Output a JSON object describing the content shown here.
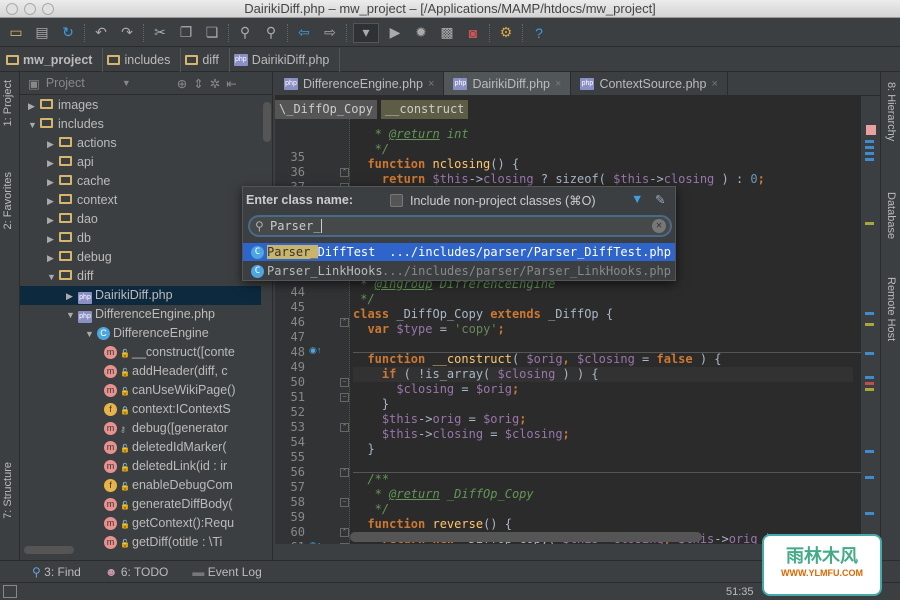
{
  "window": {
    "title": "DairikiDiff.php – mw_project – [/Applications/MAMP/htdocs/mw_project]"
  },
  "toolbar": {
    "icons": [
      "open-folder-icon",
      "save-icon",
      "sync-icon",
      "undo-icon",
      "redo-icon",
      "cut-icon",
      "copy-icon",
      "paste-icon",
      "find-icon",
      "replace-icon",
      "back-icon",
      "forward-icon",
      "run-config-dropdown",
      "run-icon",
      "debug-icon",
      "coverage-icon",
      "phpunit-icon",
      "settings-icon",
      "help-icon"
    ]
  },
  "navbar": {
    "crumbs": [
      "mw_project",
      "includes",
      "diff",
      "DairikiDiff.php"
    ]
  },
  "left_strip": {
    "tabs": [
      "1: Project",
      "2: Favorites",
      "7: Structure"
    ]
  },
  "project": {
    "title": "Project",
    "tree": [
      {
        "label": "images",
        "type": "folder",
        "depth": 0,
        "open": false
      },
      {
        "label": "includes",
        "type": "folder",
        "depth": 0,
        "open": true
      },
      {
        "label": "actions",
        "type": "folder",
        "depth": 1,
        "open": false
      },
      {
        "label": "api",
        "type": "folder",
        "depth": 1,
        "open": false
      },
      {
        "label": "cache",
        "type": "folder",
        "depth": 1,
        "open": false
      },
      {
        "label": "context",
        "type": "folder",
        "depth": 1,
        "open": false
      },
      {
        "label": "dao",
        "type": "folder",
        "depth": 1,
        "open": false
      },
      {
        "label": "db",
        "type": "folder",
        "depth": 1,
        "open": false
      },
      {
        "label": "debug",
        "type": "folder",
        "depth": 1,
        "open": false
      },
      {
        "label": "diff",
        "type": "folder",
        "depth": 1,
        "open": true
      },
      {
        "label": "DairikiDiff.php",
        "type": "php",
        "depth": 2,
        "open": false,
        "selected": true
      },
      {
        "label": "DifferenceEngine.php",
        "type": "php",
        "depth": 2,
        "open": true
      },
      {
        "label": "DifferenceEngine",
        "type": "class",
        "depth": 3,
        "open": true
      },
      {
        "label": "__construct([conte",
        "type": "m",
        "depth": 4,
        "vis": "public"
      },
      {
        "label": "addHeader(diff, c",
        "type": "m",
        "depth": 4,
        "vis": "public"
      },
      {
        "label": "canUseWikiPage()",
        "type": "m",
        "depth": 4,
        "vis": "public"
      },
      {
        "label": "context:IContextS",
        "type": "f",
        "depth": 4,
        "vis": "private"
      },
      {
        "label": "debug([generator",
        "type": "m",
        "depth": 4,
        "vis": "protected"
      },
      {
        "label": "deletedIdMarker(",
        "type": "m",
        "depth": 4,
        "vis": "public"
      },
      {
        "label": "deletedLink(id : ir",
        "type": "m",
        "depth": 4,
        "vis": "public"
      },
      {
        "label": "enableDebugCom",
        "type": "f",
        "depth": 4,
        "vis": "public"
      },
      {
        "label": "generateDiffBody(",
        "type": "m",
        "depth": 4,
        "vis": "public"
      },
      {
        "label": "getContext():Requ",
        "type": "m",
        "depth": 4,
        "vis": "public"
      },
      {
        "label": "getDiff(otitle : \\Ti",
        "type": "m",
        "depth": 4,
        "vis": "public"
      }
    ]
  },
  "tabs": [
    {
      "label": "DifferenceEngine.php",
      "active": false
    },
    {
      "label": "DairikiDiff.php",
      "active": true
    },
    {
      "label": "ContextSource.php",
      "active": false
    }
  ],
  "editor": {
    "breadcrumb": [
      "\\_DiffOp_Copy",
      "__construct"
    ],
    "lines": [
      {
        "n": 35,
        "t": [
          [
            "cm",
            "   * "
          ],
          [
            "tag",
            "@return"
          ],
          [
            "cm",
            " int"
          ]
        ]
      },
      {
        "n": 36,
        "t": [
          [
            "cm",
            "   */"
          ]
        ]
      },
      {
        "n": 37,
        "t": [
          [
            "kw",
            "  function "
          ],
          [
            "fn",
            "nclosing"
          ],
          [
            "",
            "() {"
          ]
        ]
      },
      {
        "n": 38,
        "t": [
          [
            "kw",
            "    return "
          ],
          [
            "var",
            "$this"
          ],
          [
            "",
            "->"
          ],
          [
            "var",
            "closing"
          ],
          [
            "",
            " ? sizeof( "
          ],
          [
            "var",
            "$this"
          ],
          [
            "",
            "->"
          ],
          [
            "var",
            "closing"
          ],
          [
            "",
            " ) : "
          ],
          [
            "num",
            "0"
          ],
          [
            "kw",
            ";"
          ]
        ]
      },
      {
        "n": 39,
        "t": [
          [
            "",
            "  }"
          ]
        ]
      },
      {
        "n": 40,
        "t": []
      },
      {
        "n": 41,
        "t": []
      },
      {
        "n": 42,
        "t": []
      },
      {
        "n": 43,
        "t": []
      },
      {
        "n": 44,
        "t": []
      },
      {
        "n": 45,
        "t": [
          [
            "cm",
            " * "
          ],
          [
            "tag",
            "@ingroup"
          ],
          [
            "cm",
            " DifferenceEngine"
          ]
        ]
      },
      {
        "n": 46,
        "t": [
          [
            "cm",
            " */"
          ]
        ]
      },
      {
        "n": 47,
        "t": [
          [
            "kw",
            "class "
          ],
          [
            "",
            "_DiffOp_Copy "
          ],
          [
            "kw",
            "extends "
          ],
          [
            "",
            "_DiffOp {"
          ]
        ]
      },
      {
        "n": 48,
        "t": [
          [
            "kw",
            "  var "
          ],
          [
            "var",
            "$type"
          ],
          [
            "",
            " = "
          ],
          [
            "str",
            "'copy'"
          ],
          [
            "kw",
            ";"
          ]
        ]
      },
      {
        "n": 49,
        "t": []
      },
      {
        "n": 50,
        "t": [
          [
            "kw",
            "  function "
          ],
          [
            "fn",
            "__construct"
          ],
          [
            "",
            "( "
          ],
          [
            "var",
            "$orig"
          ],
          [
            "kw",
            ", "
          ],
          [
            "var",
            "$closing"
          ],
          [
            "",
            " = "
          ],
          [
            "kw",
            "false"
          ],
          [
            "",
            " ) {"
          ]
        ]
      },
      {
        "n": 51,
        "t": [
          [
            "kw",
            "    if "
          ],
          [
            "",
            "( !is_array( "
          ],
          [
            "var",
            "$closing"
          ],
          [
            "",
            " ) ) {"
          ]
        ]
      },
      {
        "n": 52,
        "t": [
          [
            "var",
            "      $closing"
          ],
          [
            "",
            " = "
          ],
          [
            "var",
            "$orig"
          ],
          [
            "kw",
            ";"
          ]
        ]
      },
      {
        "n": 53,
        "t": [
          [
            "",
            "    }"
          ]
        ]
      },
      {
        "n": 54,
        "t": [
          [
            "var",
            "    $this"
          ],
          [
            "",
            "->"
          ],
          [
            "var",
            "orig"
          ],
          [
            "",
            " = "
          ],
          [
            "var",
            "$orig"
          ],
          [
            "kw",
            ";"
          ]
        ]
      },
      {
        "n": 55,
        "t": [
          [
            "var",
            "    $this"
          ],
          [
            "",
            "->"
          ],
          [
            "var",
            "closing"
          ],
          [
            "",
            " = "
          ],
          [
            "var",
            "$closing"
          ],
          [
            "kw",
            ";"
          ]
        ]
      },
      {
        "n": 56,
        "t": [
          [
            "",
            "  }"
          ]
        ]
      },
      {
        "n": 57,
        "t": []
      },
      {
        "n": 58,
        "t": [
          [
            "cm",
            "  /**"
          ]
        ]
      },
      {
        "n": 59,
        "t": [
          [
            "cm",
            "   * "
          ],
          [
            "tag",
            "@return"
          ],
          [
            "cm",
            " _DiffOp_Copy"
          ]
        ]
      },
      {
        "n": 60,
        "t": [
          [
            "cm",
            "   */"
          ]
        ]
      },
      {
        "n": 61,
        "t": [
          [
            "kw",
            "  function "
          ],
          [
            "fn",
            "reverse"
          ],
          [
            "",
            "() {"
          ]
        ]
      },
      {
        "n": 62,
        "t": [
          [
            "kw",
            "    return new "
          ],
          [
            "",
            "_DiffOp_Copy( "
          ],
          [
            "var",
            "$this"
          ],
          [
            "",
            "->"
          ],
          [
            "var",
            "closing"
          ],
          [
            "kw",
            ", "
          ],
          [
            "var",
            "$this"
          ],
          [
            "",
            "->"
          ],
          [
            "var",
            "orig"
          ],
          [
            "",
            " );"
          ]
        ]
      }
    ]
  },
  "popup": {
    "label": "Enter class name:",
    "checkbox_label": "Include non-project classes (⌘O)",
    "checkbox_checked": false,
    "query": "Parser_",
    "results": [
      {
        "name": "Parser_DiffTest",
        "match": "Parser_",
        "rest": "DiffTest",
        "path": ".../includes/parser/Parser_DiffTest.php",
        "selected": true
      },
      {
        "name": "Parser_LinkHooks",
        "match": "Parser_",
        "rest": "LinkHooks",
        "path": ".../includes/parser/Parser_LinkHooks.php",
        "selected": false
      }
    ]
  },
  "right_strip": {
    "tabs": [
      "8: Hierarchy",
      "Database",
      "Remote Host"
    ]
  },
  "bottom": {
    "tools": [
      "3: Find",
      "6: TODO",
      "Event Log"
    ]
  },
  "status": {
    "position": "51:35"
  },
  "watermark": {
    "text": "雨林木风",
    "url": "WWW.YLMFU.COM"
  },
  "colors": {
    "background": "#2b2b2b",
    "keyword": "#cc7832",
    "variable": "#9876aa",
    "comment": "#629755",
    "string": "#6a8759",
    "selection": "#2f65ca"
  }
}
